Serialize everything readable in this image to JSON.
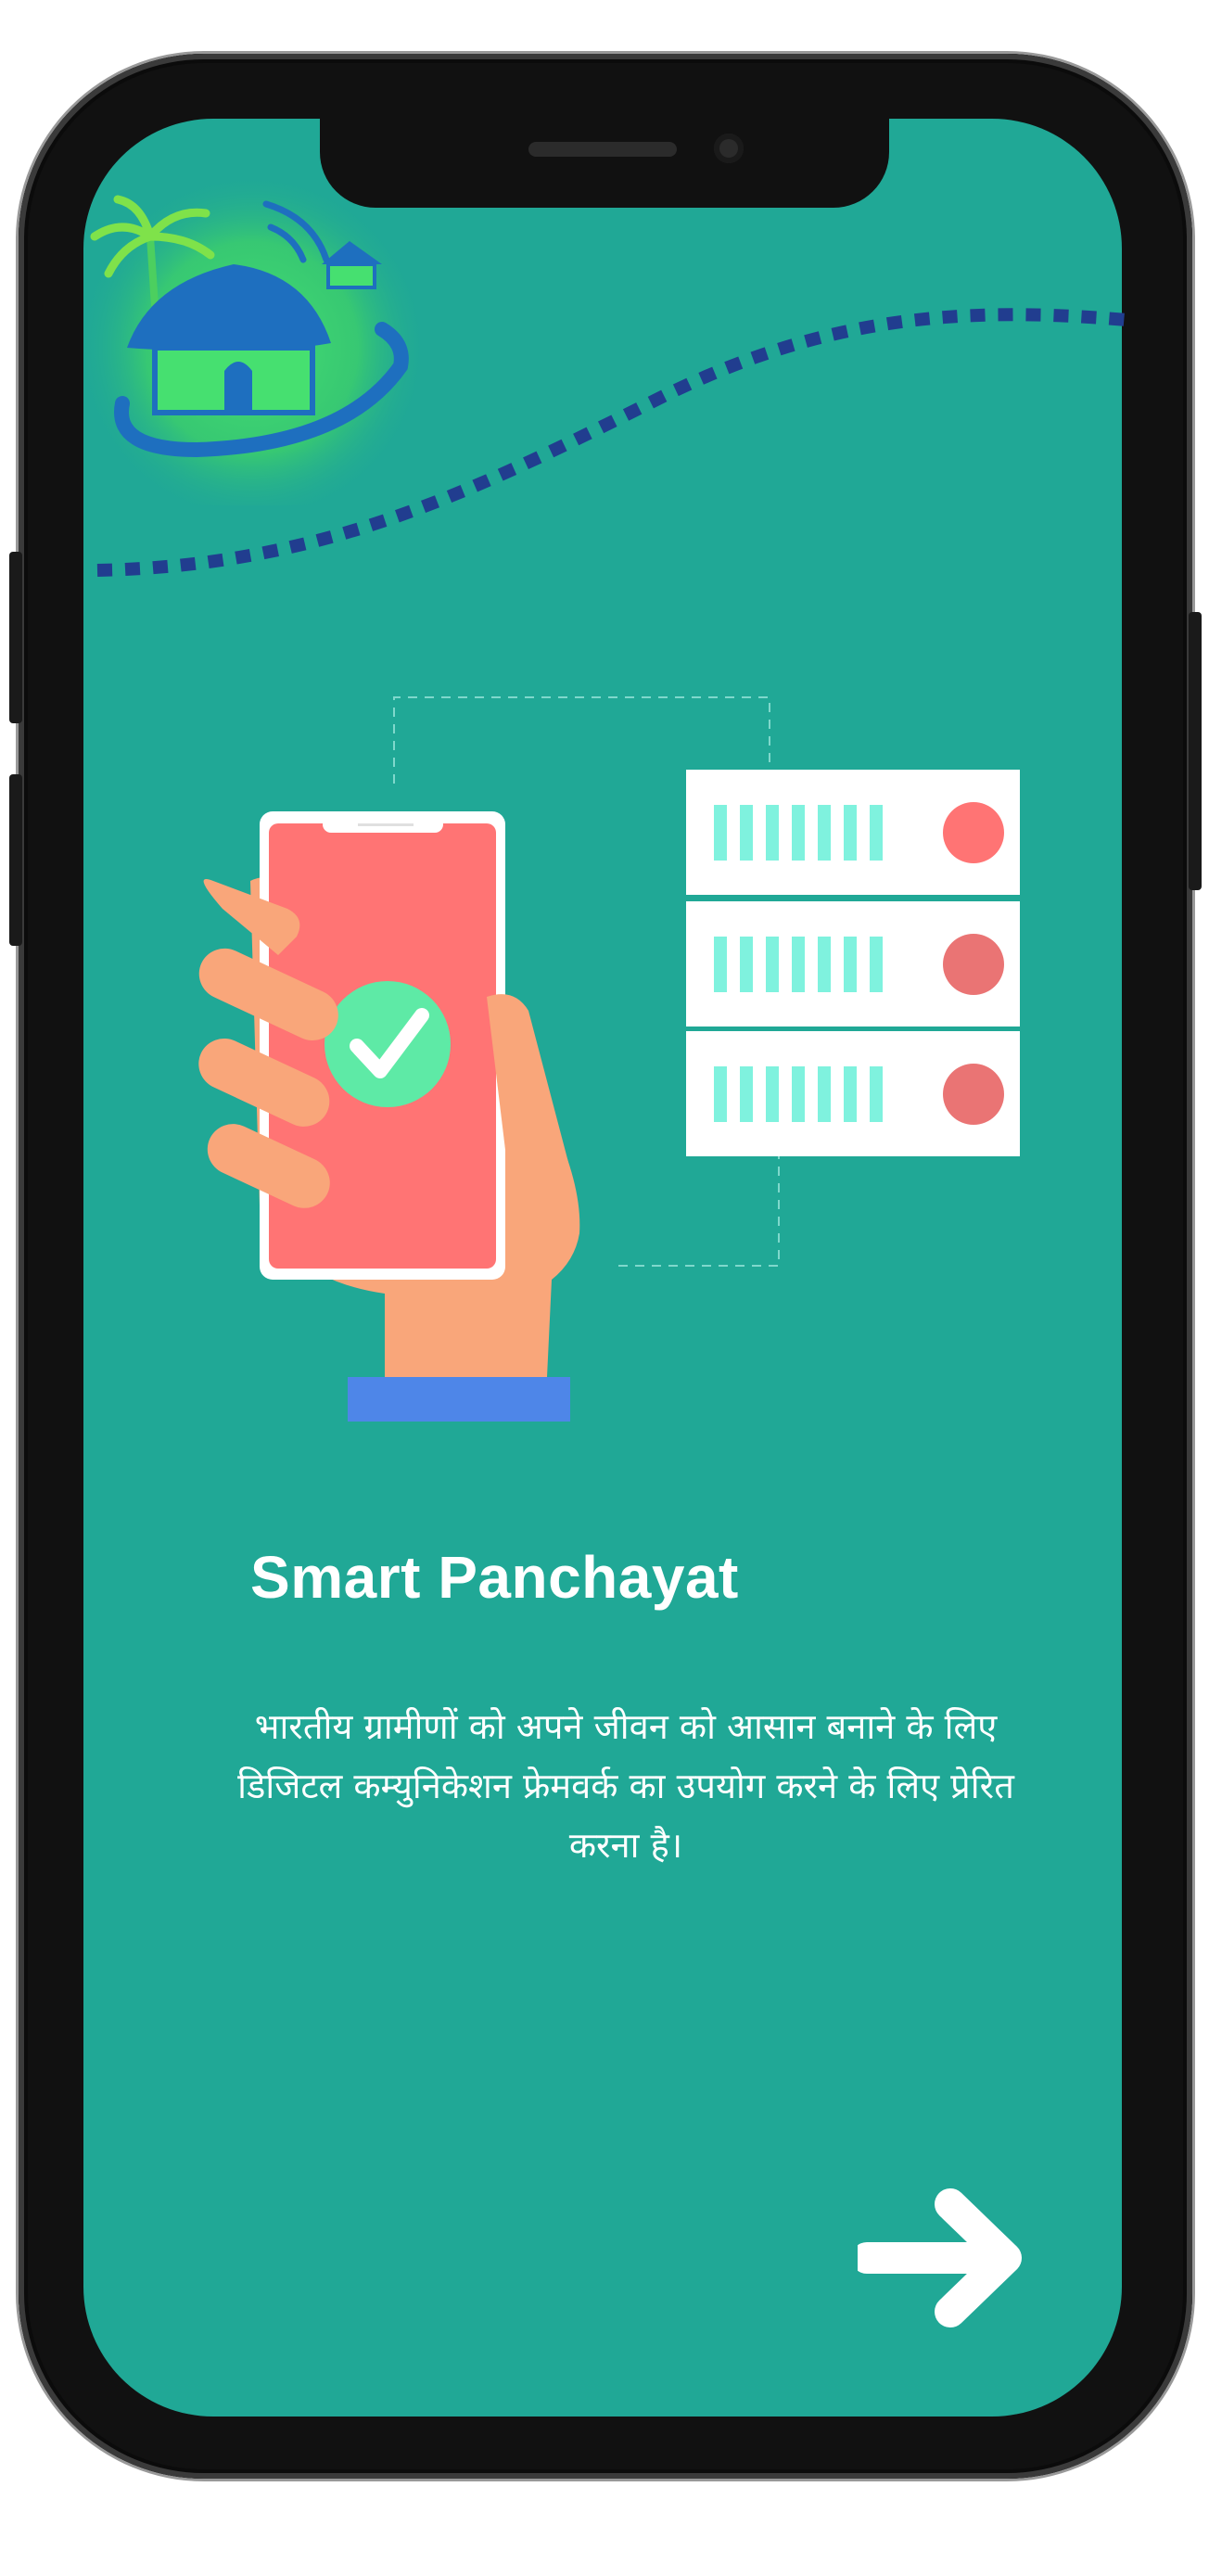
{
  "onboarding": {
    "title": "Smart Panchayat",
    "description": "भारतीय ग्रामीणों को अपने जीवन को आसान बनाने के लिए डिजिटल कम्युनिकेशन फ्रेमवर्क का उपयोग करने के लिए प्रेरित करना है।",
    "next_icon": "arrow-right-icon"
  },
  "colors": {
    "screen_bg": "#20a896",
    "phone_red": "#ff7474",
    "hand": "#f9a67a",
    "sleeve": "#4e86e8",
    "check": "#5eeaa6",
    "dash": "#213d8f"
  }
}
